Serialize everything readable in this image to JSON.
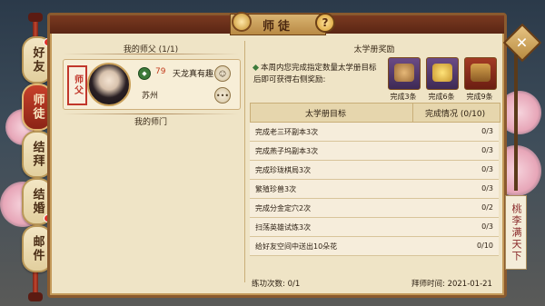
{
  "title": "师徒",
  "help_label": "?",
  "side_tabs": [
    {
      "label": "好友",
      "active": false,
      "dot": true
    },
    {
      "label": "师徒",
      "active": true,
      "dot": false
    },
    {
      "label": "结拜",
      "active": false,
      "dot": false
    },
    {
      "label": "结婚",
      "active": false,
      "dot": false
    },
    {
      "label": "邮件",
      "active": false,
      "dot": true
    }
  ],
  "left": {
    "my_master_label": "我的师父 (1/1)",
    "master_tag": "师父",
    "master": {
      "level": "79",
      "name": "天龙真有趣",
      "location": "苏州",
      "more_label": "•••"
    },
    "my_school_label": "我的师门"
  },
  "right": {
    "reward_title": "太学册奖励",
    "reward_desc": "本周内您完成指定数量太学册目标后即可获得右侧奖励:",
    "rewards": [
      {
        "label": "完成3条",
        "icon": "money-bag-icon"
      },
      {
        "label": "完成6条",
        "icon": "gold-ingot-icon"
      },
      {
        "label": "完成9条",
        "icon": "treasure-chest-icon"
      }
    ],
    "table_headers": {
      "goal": "太学册目标",
      "progress": "完成情况 (0/10)"
    },
    "rows": [
      {
        "goal": "完成老三环副本3次",
        "progress": "0/3"
      },
      {
        "goal": "完成燕子坞副本3次",
        "progress": "0/3"
      },
      {
        "goal": "完成珍珑棋局3次",
        "progress": "0/3"
      },
      {
        "goal": "繁殖珍兽3次",
        "progress": "0/3"
      },
      {
        "goal": "完成分金定穴2次",
        "progress": "0/2"
      },
      {
        "goal": "扫荡英雄试炼3次",
        "progress": "0/3"
      },
      {
        "goal": "给好友空间中送出10朵花",
        "progress": "0/10"
      }
    ],
    "practice_count": "练功次数: 0/1",
    "apprentice_time": "拜师时间: 2021-01-21"
  },
  "scroll_text": "桃李满天下",
  "close_label": "✕"
}
